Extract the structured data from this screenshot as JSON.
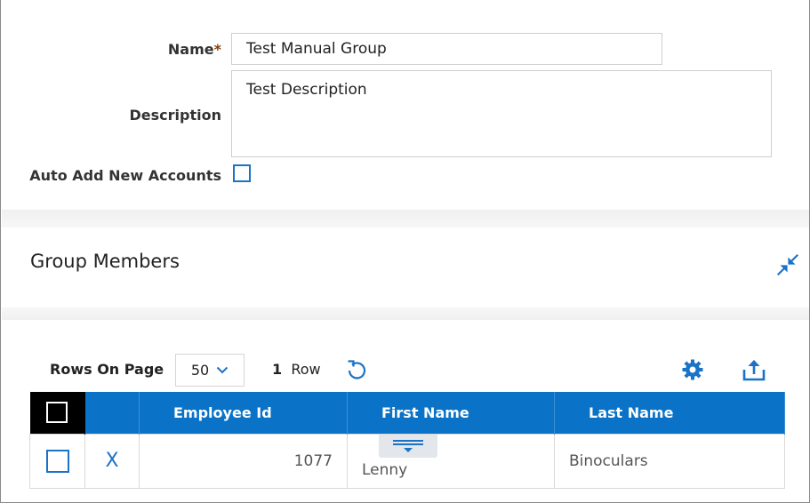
{
  "form": {
    "name_label": "Name",
    "name_required_marker": "*",
    "name_value": "Test Manual Group",
    "description_label": "Description",
    "description_value": "Test Description",
    "auto_add_label": "Auto Add New Accounts",
    "auto_add_checked": false
  },
  "members": {
    "title": "Group Members",
    "rows_on_page_label": "Rows On Page",
    "rows_on_page_value": "50",
    "row_count": "1",
    "row_count_label": "Row",
    "columns": [
      "Employee Id",
      "First Name",
      "Last Name"
    ],
    "rows": [
      {
        "employee_id": "1077",
        "first_name": "Lenny",
        "last_name": "Binoculars",
        "remove_label": "X"
      }
    ]
  },
  "icons": {
    "collapse": "collapse-arrows-icon",
    "refresh": "refresh-icon",
    "settings": "gear-icon",
    "export": "upload-icon",
    "dropdown": "chevron-down-icon",
    "filter": "filter-lines-icon"
  },
  "colors": {
    "accent": "#1a73c6",
    "header_bg": "#0a73c7",
    "required": "#8a3a00"
  }
}
